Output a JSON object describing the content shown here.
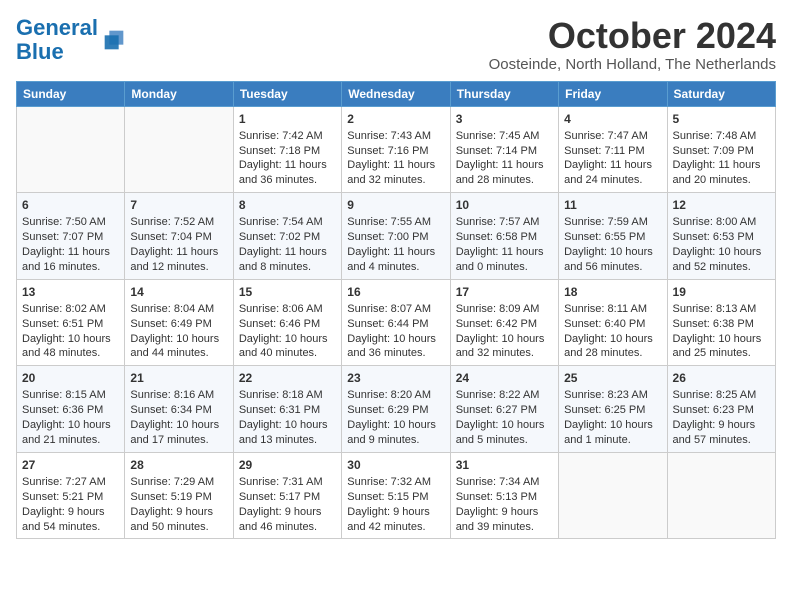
{
  "header": {
    "logo_line1": "General",
    "logo_line2": "Blue",
    "month_title": "October 2024",
    "subtitle": "Oosteinde, North Holland, The Netherlands"
  },
  "days_of_week": [
    "Sunday",
    "Monday",
    "Tuesday",
    "Wednesday",
    "Thursday",
    "Friday",
    "Saturday"
  ],
  "weeks": [
    [
      {
        "day": "",
        "content": ""
      },
      {
        "day": "",
        "content": ""
      },
      {
        "day": "1",
        "content": "Sunrise: 7:42 AM\nSunset: 7:18 PM\nDaylight: 11 hours and 36 minutes."
      },
      {
        "day": "2",
        "content": "Sunrise: 7:43 AM\nSunset: 7:16 PM\nDaylight: 11 hours and 32 minutes."
      },
      {
        "day": "3",
        "content": "Sunrise: 7:45 AM\nSunset: 7:14 PM\nDaylight: 11 hours and 28 minutes."
      },
      {
        "day": "4",
        "content": "Sunrise: 7:47 AM\nSunset: 7:11 PM\nDaylight: 11 hours and 24 minutes."
      },
      {
        "day": "5",
        "content": "Sunrise: 7:48 AM\nSunset: 7:09 PM\nDaylight: 11 hours and 20 minutes."
      }
    ],
    [
      {
        "day": "6",
        "content": "Sunrise: 7:50 AM\nSunset: 7:07 PM\nDaylight: 11 hours and 16 minutes."
      },
      {
        "day": "7",
        "content": "Sunrise: 7:52 AM\nSunset: 7:04 PM\nDaylight: 11 hours and 12 minutes."
      },
      {
        "day": "8",
        "content": "Sunrise: 7:54 AM\nSunset: 7:02 PM\nDaylight: 11 hours and 8 minutes."
      },
      {
        "day": "9",
        "content": "Sunrise: 7:55 AM\nSunset: 7:00 PM\nDaylight: 11 hours and 4 minutes."
      },
      {
        "day": "10",
        "content": "Sunrise: 7:57 AM\nSunset: 6:58 PM\nDaylight: 11 hours and 0 minutes."
      },
      {
        "day": "11",
        "content": "Sunrise: 7:59 AM\nSunset: 6:55 PM\nDaylight: 10 hours and 56 minutes."
      },
      {
        "day": "12",
        "content": "Sunrise: 8:00 AM\nSunset: 6:53 PM\nDaylight: 10 hours and 52 minutes."
      }
    ],
    [
      {
        "day": "13",
        "content": "Sunrise: 8:02 AM\nSunset: 6:51 PM\nDaylight: 10 hours and 48 minutes."
      },
      {
        "day": "14",
        "content": "Sunrise: 8:04 AM\nSunset: 6:49 PM\nDaylight: 10 hours and 44 minutes."
      },
      {
        "day": "15",
        "content": "Sunrise: 8:06 AM\nSunset: 6:46 PM\nDaylight: 10 hours and 40 minutes."
      },
      {
        "day": "16",
        "content": "Sunrise: 8:07 AM\nSunset: 6:44 PM\nDaylight: 10 hours and 36 minutes."
      },
      {
        "day": "17",
        "content": "Sunrise: 8:09 AM\nSunset: 6:42 PM\nDaylight: 10 hours and 32 minutes."
      },
      {
        "day": "18",
        "content": "Sunrise: 8:11 AM\nSunset: 6:40 PM\nDaylight: 10 hours and 28 minutes."
      },
      {
        "day": "19",
        "content": "Sunrise: 8:13 AM\nSunset: 6:38 PM\nDaylight: 10 hours and 25 minutes."
      }
    ],
    [
      {
        "day": "20",
        "content": "Sunrise: 8:15 AM\nSunset: 6:36 PM\nDaylight: 10 hours and 21 minutes."
      },
      {
        "day": "21",
        "content": "Sunrise: 8:16 AM\nSunset: 6:34 PM\nDaylight: 10 hours and 17 minutes."
      },
      {
        "day": "22",
        "content": "Sunrise: 8:18 AM\nSunset: 6:31 PM\nDaylight: 10 hours and 13 minutes."
      },
      {
        "day": "23",
        "content": "Sunrise: 8:20 AM\nSunset: 6:29 PM\nDaylight: 10 hours and 9 minutes."
      },
      {
        "day": "24",
        "content": "Sunrise: 8:22 AM\nSunset: 6:27 PM\nDaylight: 10 hours and 5 minutes."
      },
      {
        "day": "25",
        "content": "Sunrise: 8:23 AM\nSunset: 6:25 PM\nDaylight: 10 hours and 1 minute."
      },
      {
        "day": "26",
        "content": "Sunrise: 8:25 AM\nSunset: 6:23 PM\nDaylight: 9 hours and 57 minutes."
      }
    ],
    [
      {
        "day": "27",
        "content": "Sunrise: 7:27 AM\nSunset: 5:21 PM\nDaylight: 9 hours and 54 minutes."
      },
      {
        "day": "28",
        "content": "Sunrise: 7:29 AM\nSunset: 5:19 PM\nDaylight: 9 hours and 50 minutes."
      },
      {
        "day": "29",
        "content": "Sunrise: 7:31 AM\nSunset: 5:17 PM\nDaylight: 9 hours and 46 minutes."
      },
      {
        "day": "30",
        "content": "Sunrise: 7:32 AM\nSunset: 5:15 PM\nDaylight: 9 hours and 42 minutes."
      },
      {
        "day": "31",
        "content": "Sunrise: 7:34 AM\nSunset: 5:13 PM\nDaylight: 9 hours and 39 minutes."
      },
      {
        "day": "",
        "content": ""
      },
      {
        "day": "",
        "content": ""
      }
    ]
  ]
}
